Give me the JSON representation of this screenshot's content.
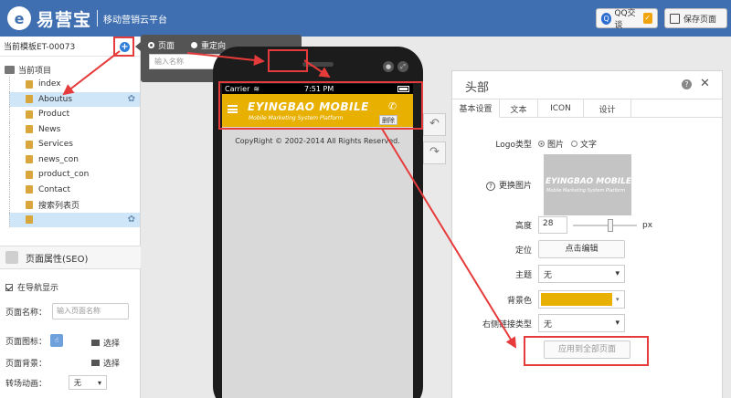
{
  "header": {
    "brand_mark": "e",
    "brand_name": "易营宝",
    "brand_sub": "移动营销云平台",
    "qq_label": "QQ交谈",
    "qq_icon": "Q",
    "qq_badge": "✓",
    "save_label": "保存页面"
  },
  "left": {
    "template_label": "当前模板ET-00073",
    "add_symbol": "+",
    "project_label": "当前项目",
    "tree": [
      {
        "label": "index",
        "selected": false,
        "gear": false
      },
      {
        "label": "Aboutus",
        "selected": true,
        "gear": true
      },
      {
        "label": "Product",
        "selected": false,
        "gear": false
      },
      {
        "label": "News",
        "selected": false,
        "gear": false
      },
      {
        "label": "Services",
        "selected": false,
        "gear": false
      },
      {
        "label": "news_con",
        "selected": false,
        "gear": false
      },
      {
        "label": "product_con",
        "selected": false,
        "gear": false
      },
      {
        "label": "Contact",
        "selected": false,
        "gear": false
      },
      {
        "label": "搜索列表页",
        "selected": false,
        "gear": false
      },
      {
        "label": "",
        "selected": true,
        "gear": true
      }
    ],
    "gear_symbol": "✿",
    "seo_title": "页面属性(SEO)",
    "nav_show_label": "在导航显示",
    "page_name_label": "页面名称：",
    "page_name_placeholder": "输入页面名称",
    "page_icon_label": "页面图标：",
    "page_icon_glyph": "☝",
    "choose_label": "选择",
    "page_bg_label": "页面背景：",
    "transition_label": "转场动画：",
    "transition_value": "无",
    "select_caret": "▾"
  },
  "popup": {
    "radio_page": "页面",
    "radio_redirect": "重定向",
    "input_placeholder": "输入名称",
    "ok_label": "Ok"
  },
  "phone": {
    "carrier": "Carrier",
    "wifi": "≋",
    "time": "7:51 PM",
    "btn_a": "●",
    "btn_b": "⤢",
    "logo_main": "EYINGBAO MOBILE",
    "logo_sub": "Mobile Marketing System Platform",
    "phone_glyph": "✆",
    "delete_label": "删除",
    "copyright": "CopyRight © 2002-2014 All Rights Reserved."
  },
  "side": {
    "undo": "↶",
    "redo": "↷"
  },
  "panel": {
    "title": "头部",
    "help": "?",
    "close": "✕",
    "tabs": [
      {
        "label": "基本设置",
        "active": true
      },
      {
        "label": "文本",
        "active": false
      },
      {
        "label": "ICON",
        "active": false
      },
      {
        "label": "设计",
        "active": false
      }
    ],
    "logo_type_label": "Logo类型",
    "logo_type_image": "图片",
    "logo_type_text": "文字",
    "logo_main": "EYINGBAO MOBILE",
    "logo_sub": "Mobile Marketing System Platform",
    "change_image_label": "更换图片",
    "height_label": "高度",
    "height_value": "28",
    "height_unit": "px",
    "position_label": "定位",
    "position_button": "点击编辑",
    "theme_label": "主题",
    "theme_value": "无",
    "bg_color_label": "背景色",
    "bg_color": "#e8b000",
    "link_type_label": "右侧链接类型",
    "link_type_value": "无",
    "apply_label": "应用到全部页面"
  },
  "colors": {
    "brand": "#3f6fb0",
    "annotation": "#e63b3b",
    "header_yellow": "#e8b000"
  }
}
